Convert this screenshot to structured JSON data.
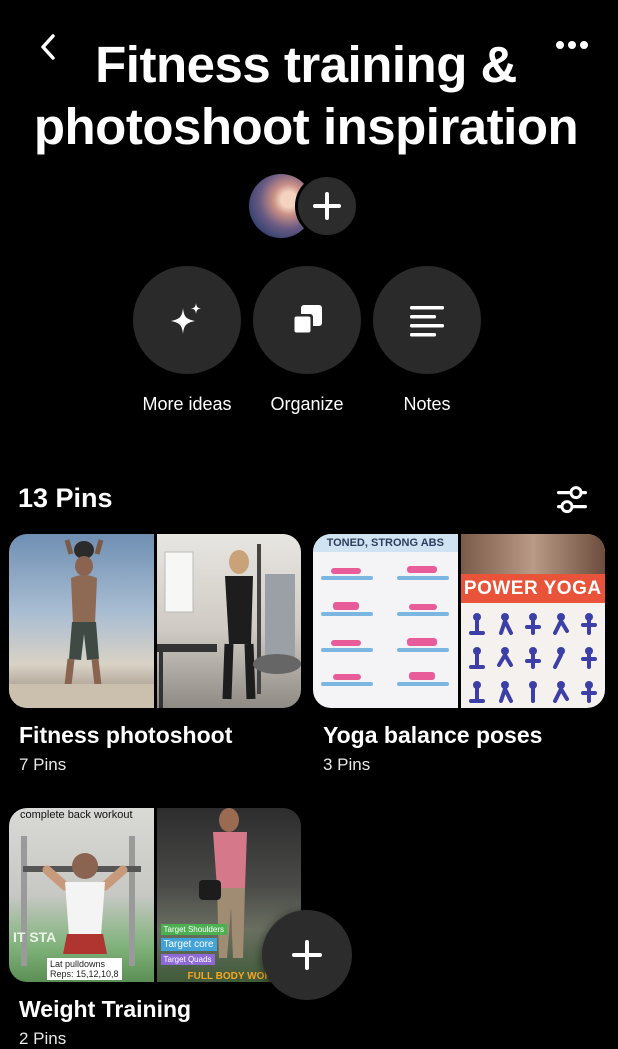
{
  "header": {
    "title": "Fitness training & photoshoot inspiration"
  },
  "icons": {
    "back": "chevron-left-icon",
    "more": "ellipsis-icon",
    "add_collaborator": "plus-icon",
    "more_ideas": "sparkle-icon",
    "organize": "organize-icon",
    "notes": "notes-icon",
    "filter": "sliders-icon",
    "create": "plus-icon"
  },
  "actions": [
    {
      "label": "More ideas"
    },
    {
      "label": "Organize"
    },
    {
      "label": "Notes"
    }
  ],
  "pins_count": "13 Pins",
  "boards": [
    {
      "title": "Fitness photoshoot",
      "count": "7 Pins"
    },
    {
      "title": "Yoga balance poses",
      "count": "3 Pins",
      "left_text": "TONED, STRONG ABS",
      "right_banner": "POWER YOGA"
    },
    {
      "title": "Weight Training",
      "count": "2 Pins",
      "overlay_top": "complete back workout",
      "tags": [
        "Target Shoulders",
        "Target core",
        "Target Quads"
      ],
      "caption": "Lat pulldowns\nReps: 15,12,10,8",
      "banner": "FULL BODY WORK"
    }
  ],
  "colors": {
    "background": "#000000",
    "button_bg": "#2a2a2a",
    "text": "#ffffff",
    "yoga_banner": "#e8533a"
  }
}
